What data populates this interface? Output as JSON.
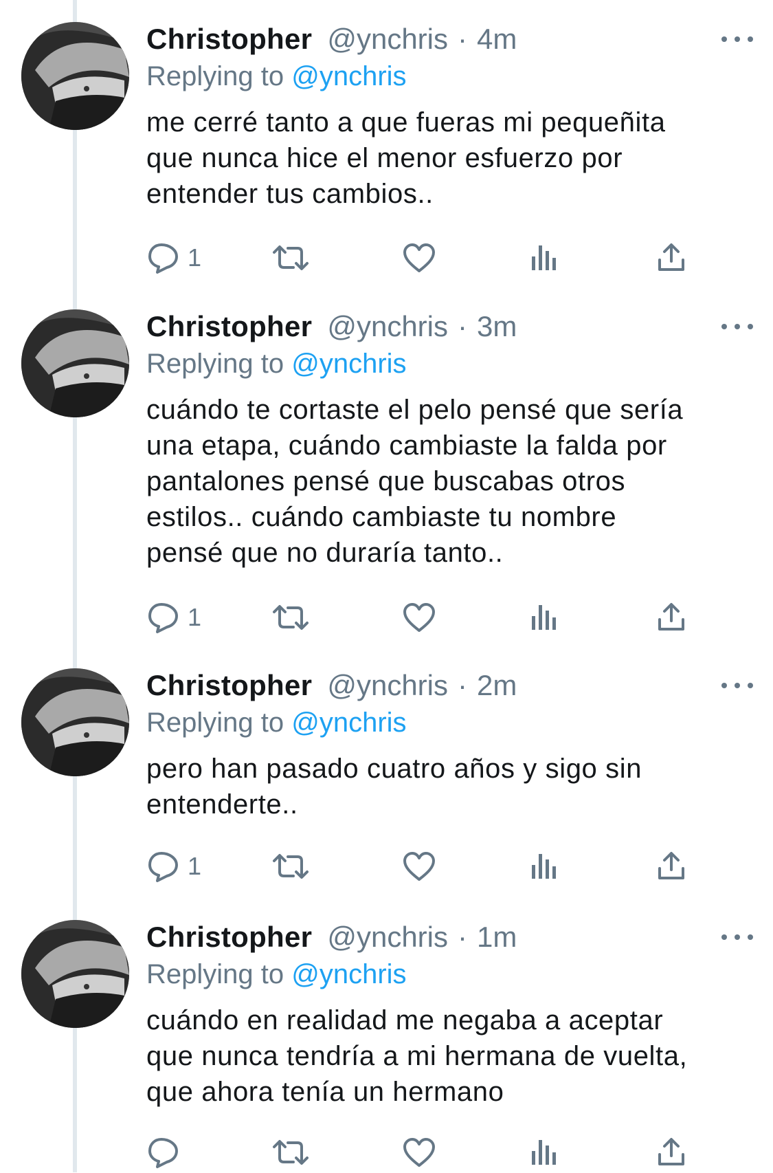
{
  "tweets": [
    {
      "name": "Christopher",
      "handle": "@ynchris",
      "separator": "·",
      "time": "4m",
      "replying_prefix": "Replying to",
      "replying_to": "@ynchris",
      "lines": [
        "me cerré tanto a que fueras mi pequeñita",
        "que nunca hice el menor esfuerzo por",
        "entender tus cambios.."
      ],
      "reply_count": "1"
    },
    {
      "name": "Christopher",
      "handle": "@ynchris",
      "separator": "·",
      "time": "3m",
      "replying_prefix": "Replying to",
      "replying_to": "@ynchris",
      "lines": [
        "cuándo te cortaste el pelo pensé que sería",
        "una etapa, cuándo cambiaste la falda por",
        "pantalones pensé que buscabas otros",
        "estilos.. cuándo cambiaste tu nombre",
        "pensé que no duraría tanto.."
      ],
      "reply_count": "1"
    },
    {
      "name": "Christopher",
      "handle": "@ynchris",
      "separator": "·",
      "time": "2m",
      "replying_prefix": "Replying to",
      "replying_to": "@ynchris",
      "lines": [
        "pero han pasado cuatro años y sigo sin",
        "entenderte.."
      ],
      "reply_count": "1"
    },
    {
      "name": "Christopher",
      "handle": "@ynchris",
      "separator": "·",
      "time": "1m",
      "replying_prefix": "Replying to",
      "replying_to": "@ynchris",
      "lines": [
        "cuándo en realidad me negaba a aceptar",
        "que nunca tendría a mi hermana de vuelta,",
        "que ahora tenía un hermano"
      ],
      "reply_count": ""
    }
  ],
  "icons": {
    "reply": "reply-icon",
    "retweet": "retweet-icon",
    "like": "heart-icon",
    "analytics": "analytics-icon",
    "share": "share-icon",
    "more": "more-icon"
  },
  "colors": {
    "text": "#14171a",
    "secondary": "#657786",
    "link": "#1da1f2",
    "thread_line": "#e1e8ed"
  }
}
